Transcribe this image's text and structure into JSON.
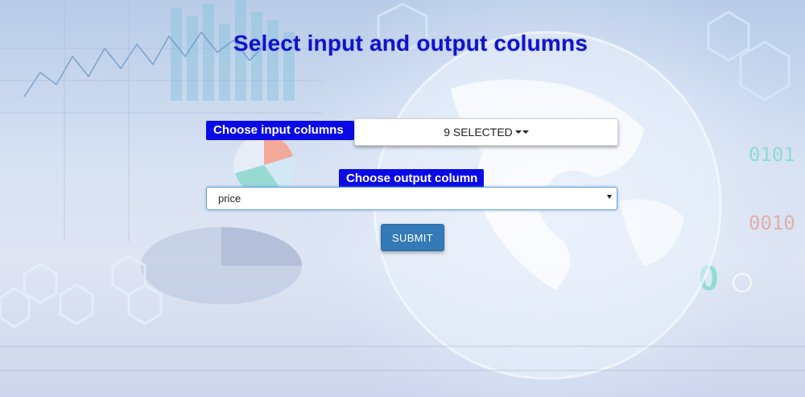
{
  "page": {
    "title": "Select input and output columns"
  },
  "input_columns": {
    "label": "Choose input columns",
    "selected_text": "9 SELECTED"
  },
  "output_column": {
    "label": "Choose output column",
    "selected_value": "price"
  },
  "submit": {
    "label": "SUBMIT"
  },
  "colors": {
    "title": "#1212c8",
    "label_bg": "#0a0ae6",
    "button_bg": "#337ab7"
  }
}
